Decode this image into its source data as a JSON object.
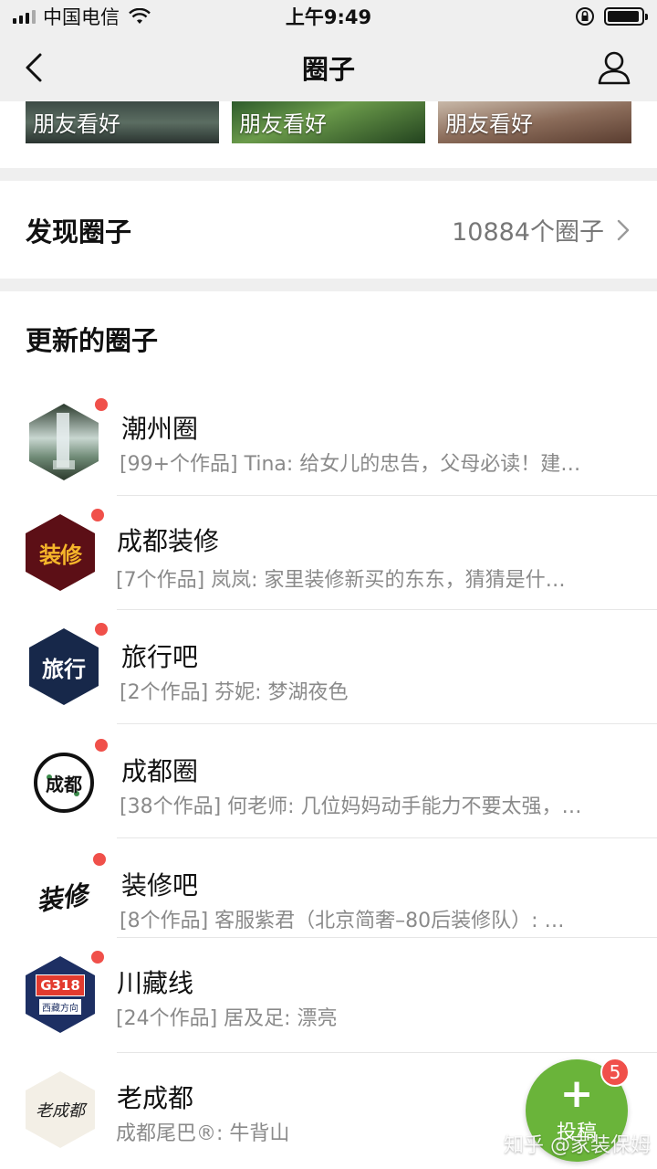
{
  "status_bar": {
    "carrier": "中国电信",
    "time": "上午9:49",
    "battery_level": 0.95
  },
  "nav": {
    "title": "圈子"
  },
  "top_cards": [
    {
      "label": "朋友看好"
    },
    {
      "label": "朋友看好"
    },
    {
      "label": "朋友看好"
    }
  ],
  "discover": {
    "title": "发现圈子",
    "count": "10884个圈子"
  },
  "updated_section": {
    "title": "更新的圈子",
    "items": [
      {
        "name": "潮州圈",
        "desc": "[99+个作品] Tina: 给女儿的忠告，父母必读！建…",
        "unread": true
      },
      {
        "name": "成都装修",
        "desc": "[7个作品] 岚岚: 家里装修新买的东东，猜猜是什…",
        "unread": true,
        "avatar_text": "装修"
      },
      {
        "name": "旅行吧",
        "desc": "[2个作品] 芬妮: 梦湖夜色",
        "unread": true,
        "avatar_text": "旅行"
      },
      {
        "name": "成都圈",
        "desc": "[38个作品] 何老师: 几位妈妈动手能力不要太强，…",
        "unread": true,
        "avatar_text": "成都"
      },
      {
        "name": "装修吧",
        "desc": "[8个作品] 客服紫君（北京简奢–80后装修队）: …",
        "unread": true,
        "avatar_text": "装修"
      },
      {
        "name": "川藏线",
        "desc": "[24个作品] 居及足: 漂亮",
        "unread": true,
        "avatar_text": "G318",
        "avatar_subtext": "西藏方向"
      },
      {
        "name": "老成都",
        "desc": "成都尾巴®: 牛背山",
        "unread": false,
        "avatar_text": "老成都"
      }
    ]
  },
  "fab": {
    "label": "投稿",
    "plus": "+",
    "badge": "5"
  },
  "watermark": "知乎 @家装保姆"
}
